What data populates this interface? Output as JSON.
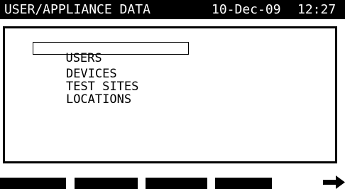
{
  "header": {
    "title": "USER/APPLIANCE DATA",
    "date": "10-Dec-09",
    "time": "12:27"
  },
  "menu": {
    "items": [
      {
        "label": "USERS",
        "selected": true
      },
      {
        "label": "DEVICES",
        "selected": false
      },
      {
        "label": "TEST SITES",
        "selected": false
      },
      {
        "label": "LOCATIONS",
        "selected": false
      }
    ]
  },
  "softkeys": {
    "count": 5,
    "arrow_icon": "right-arrow-icon"
  },
  "colors": {
    "background": "#ffffff",
    "foreground": "#000000"
  }
}
